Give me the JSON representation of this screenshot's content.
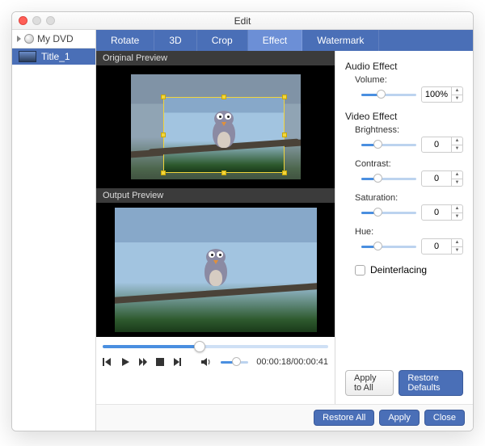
{
  "window": {
    "title": "Edit"
  },
  "sidebar": {
    "root_label": "My DVD",
    "items": [
      {
        "label": "Title_1"
      }
    ]
  },
  "tabs": [
    {
      "label": "Rotate"
    },
    {
      "label": "3D"
    },
    {
      "label": "Crop"
    },
    {
      "label": "Effect",
      "active": true
    },
    {
      "label": "Watermark"
    }
  ],
  "preview": {
    "original_label": "Original Preview",
    "output_label": "Output Preview"
  },
  "playback": {
    "position_pct": 43,
    "volume_pct": 55,
    "time_display": "00:00:18/00:00:41"
  },
  "effects": {
    "audio_heading": "Audio Effect",
    "volume_label": "Volume:",
    "volume_value": "100%",
    "volume_slider_pct": 35,
    "video_heading": "Video Effect",
    "brightness_label": "Brightness:",
    "brightness_value": "0",
    "brightness_slider_pct": 30,
    "contrast_label": "Contrast:",
    "contrast_value": "0",
    "contrast_slider_pct": 30,
    "saturation_label": "Saturation:",
    "saturation_value": "0",
    "saturation_slider_pct": 30,
    "hue_label": "Hue:",
    "hue_value": "0",
    "hue_slider_pct": 30,
    "deinterlacing_label": "Deinterlacing"
  },
  "buttons": {
    "apply_to_all": "Apply to All",
    "restore_defaults": "Restore Defaults",
    "restore_all": "Restore All",
    "apply": "Apply",
    "close": "Close"
  }
}
